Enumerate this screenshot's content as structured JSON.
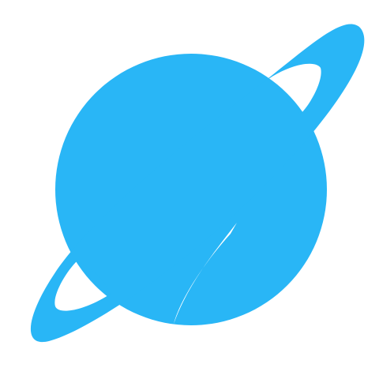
{
  "icon": {
    "name": "planet-ring-icon",
    "color": "#29B6F6",
    "background": "#FFFFFF"
  }
}
